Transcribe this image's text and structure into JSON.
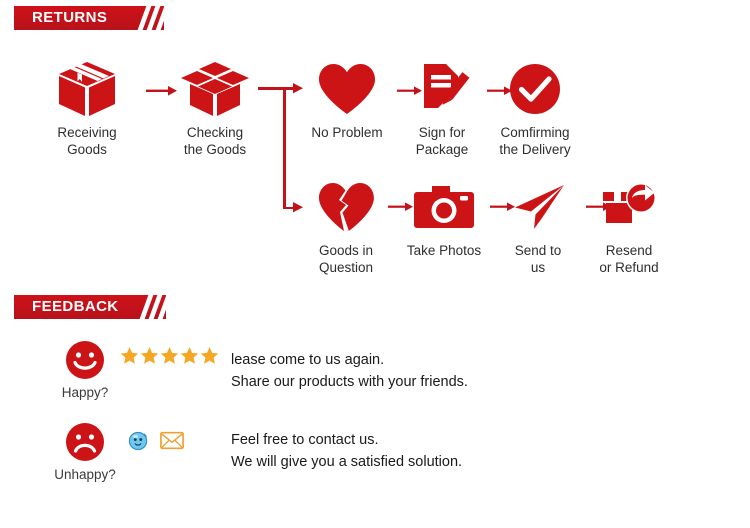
{
  "sections": {
    "returns": {
      "title": "RETURNS"
    },
    "feedback": {
      "title": "FEEDBACK"
    }
  },
  "flow": {
    "main": [
      {
        "icon": "closed-box-icon",
        "label": "Receiving\nGoods"
      },
      {
        "icon": "open-box-icon",
        "label": "Checking\nthe Goods"
      }
    ],
    "branch_ok": [
      {
        "icon": "heart-icon",
        "label": "No Problem"
      },
      {
        "icon": "sign-document-icon",
        "label": "Sign for\nPackage"
      },
      {
        "icon": "check-circle-icon",
        "label": "Comfirming\nthe Delivery"
      }
    ],
    "branch_problem": [
      {
        "icon": "broken-heart-icon",
        "label": "Goods in\nQuestion"
      },
      {
        "icon": "camera-icon",
        "label": "Take Photos"
      },
      {
        "icon": "paper-plane-icon",
        "label": "Send to\nus"
      },
      {
        "icon": "return-box-icon",
        "label": "Resend\nor Refund"
      }
    ]
  },
  "feedback": {
    "happy": {
      "face_icon": "smiley-face-icon",
      "face_label": "Happy?",
      "rating_icon": "star-icon",
      "rating": 5,
      "message": "lease come to us again.\nShare our products with your friends."
    },
    "unhappy": {
      "face_icon": "sad-face-icon",
      "face_label": "Unhappy?",
      "contact_icons": [
        "chat-bubble-icon",
        "envelope-icon"
      ],
      "message": "Feel free to contact us.\nWe will give you a satisfied solution."
    }
  },
  "colors": {
    "brand_red": "#c3121a",
    "icon_red": "#cc1316",
    "star_gold": "#f5a623",
    "envelope_orange": "#f0a02e",
    "chat_blue": "#35a8e0"
  }
}
